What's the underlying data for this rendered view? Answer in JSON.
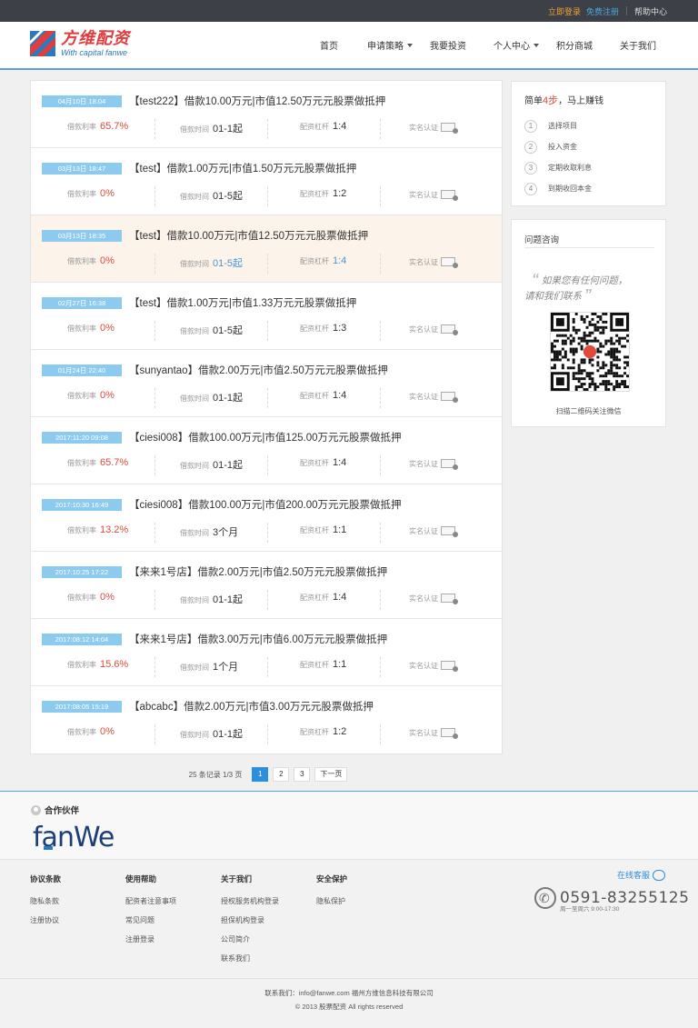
{
  "topbar": {
    "login": "立即登录",
    "register": "免费注册",
    "help": "帮助中心"
  },
  "logo": {
    "cn": "方维配资",
    "en": "With capital fanwe"
  },
  "nav": [
    {
      "label": "首页",
      "dropdown": false
    },
    {
      "label": "申请策略",
      "dropdown": true
    },
    {
      "label": "我要投资",
      "dropdown": false
    },
    {
      "label": "个人中心",
      "dropdown": true
    },
    {
      "label": "积分商城",
      "dropdown": false
    },
    {
      "label": "关于我们",
      "dropdown": false
    }
  ],
  "labels": {
    "rate": "借款利率",
    "time": "借款时间",
    "leverage": "配资杠杆",
    "verify": "实名认证"
  },
  "loans": [
    {
      "date": "04月10日 18:04",
      "title": "【test222】借款10.00万元|市值12.50万元元股票做抵押",
      "rate": "65.7%",
      "time": "01-1起",
      "leverage": "1:4",
      "highlight": false
    },
    {
      "date": "03月13日 18:47",
      "title": "【test】借款1.00万元|市值1.50万元元股票做抵押",
      "rate": "0%",
      "time": "01-5起",
      "leverage": "1:2",
      "highlight": false
    },
    {
      "date": "03月13日 18:35",
      "title": "【test】借款10.00万元|市值12.50万元元股票做抵押",
      "rate": "0%",
      "time": "01-5起",
      "leverage": "1:4",
      "highlight": true
    },
    {
      "date": "02月27日 16:38",
      "title": "【test】借款1.00万元|市值1.33万元元股票做抵押",
      "rate": "0%",
      "time": "01-5起",
      "leverage": "1:3",
      "highlight": false
    },
    {
      "date": "01月24日 22:40",
      "title": "【sunyantao】借款2.00万元|市值2.50万元元股票做抵押",
      "rate": "0%",
      "time": "01-1起",
      "leverage": "1:4",
      "highlight": false
    },
    {
      "date": "2017:11:20 09:08",
      "title": "【ciesi008】借款100.00万元|市值125.00万元元股票做抵押",
      "rate": "65.7%",
      "time": "01-1起",
      "leverage": "1:4",
      "highlight": false
    },
    {
      "date": "2017:10:30 16:49",
      "title": "【ciesi008】借款100.00万元|市值200.00万元元股票做抵押",
      "rate": "13.2%",
      "time": "3个月",
      "leverage": "1:1",
      "highlight": false
    },
    {
      "date": "2017:10:25 17:22",
      "title": "【来来1号店】借款2.00万元|市值2.50万元元股票做抵押",
      "rate": "0%",
      "time": "01-1起",
      "leverage": "1:4",
      "highlight": false
    },
    {
      "date": "2017:08:12 14:04",
      "title": "【来来1号店】借款3.00万元|市值6.00万元元股票做抵押",
      "rate": "15.6%",
      "time": "1个月",
      "leverage": "1:1",
      "highlight": false
    },
    {
      "date": "2017:08:05 15:19",
      "title": "【abcabc】借款2.00万元|市值3.00万元元股票做抵押",
      "rate": "0%",
      "time": "01-1起",
      "leverage": "1:2",
      "highlight": false
    }
  ],
  "pager": {
    "info": "25 条记录 1/3 页",
    "pages": [
      "1",
      "2",
      "3"
    ],
    "current": "1",
    "next": "下一页"
  },
  "steps_box": {
    "title_pre": "简单",
    "title_num": "4步",
    "title_post": "，马上赚钱",
    "steps": [
      {
        "n": "1",
        "label": "选择项目"
      },
      {
        "n": "2",
        "label": "投入资金"
      },
      {
        "n": "3",
        "label": "定期收取利息"
      },
      {
        "n": "4",
        "label": "到期收回本金"
      }
    ]
  },
  "consult": {
    "title": "问题咨询",
    "quote1": "如果您有任何问题，",
    "quote2": "请和我们联系",
    "qr_caption": "扫描二维码关注微信"
  },
  "partners": {
    "title": "合作伙伴",
    "logo_main": "fanWe"
  },
  "footer": {
    "cols": [
      {
        "title": "协议条款",
        "links": [
          "隐私条款",
          "注册协议"
        ]
      },
      {
        "title": "使用帮助",
        "links": [
          "配资者注意事项",
          "常见问题",
          "注册登录"
        ]
      },
      {
        "title": "关于我们",
        "links": [
          "授权服务机构登录",
          "担保机构登录",
          "公司简介",
          "联系我们"
        ]
      },
      {
        "title": "安全保护",
        "links": [
          "隐私保护"
        ]
      }
    ],
    "kefu": "在线客服",
    "phone": "0591-83255125",
    "hours": "周一至周六 9:00-17:30",
    "contact": "联系我们：info@fanwe.com   福州方维信息科技有限公司",
    "copyright": "© 2013 股票配资 All rights reserved"
  }
}
